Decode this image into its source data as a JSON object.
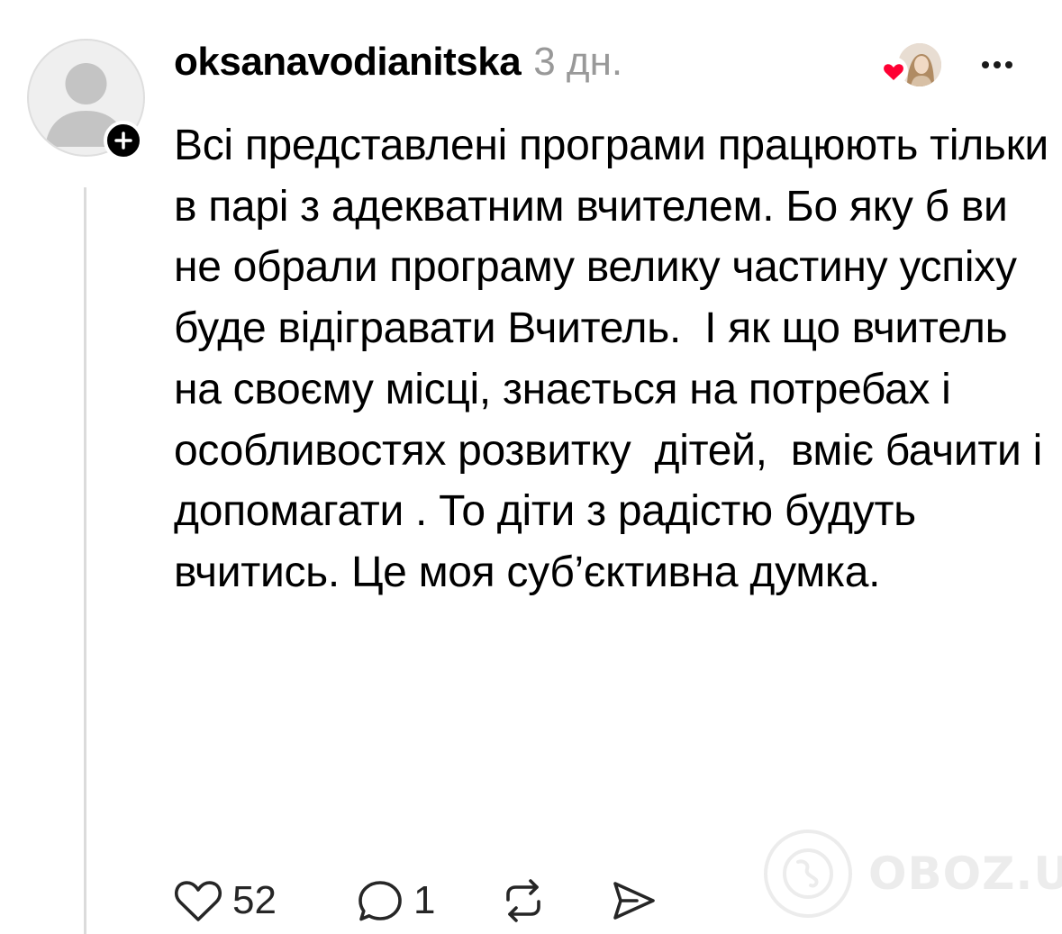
{
  "header": {
    "username": "oksanavodianitska",
    "timestamp": "3 дн."
  },
  "comment": {
    "text": "Всі представлені програми працюють тільки в парі з адекватним вчителем. Бо яку б ви не обрали програму велику частину успіху буде відігравати Вчитель.  І як що вчитель на своєму місці, знається на потребах і особливостях розвитку  дітей,  вміє бачити і допомагати . То діти з радістю будуть вчитись. Це моя суб’єктивна думка."
  },
  "actions": {
    "likes": "52",
    "replies": "1"
  },
  "icons": {
    "avatar": "default-profile-icon",
    "follow": "plus-icon",
    "liked_by": "heart-icon",
    "more": "ellipsis-icon",
    "like": "heart-outline-icon",
    "reply": "speech-bubble-icon",
    "repost": "repost-icon",
    "share": "send-icon"
  },
  "colors": {
    "text": "#000000",
    "muted": "#999999",
    "heart": "#ff0033",
    "thread_line": "#dbdbdb"
  },
  "watermark": {
    "text": "OBOZ.UA"
  }
}
